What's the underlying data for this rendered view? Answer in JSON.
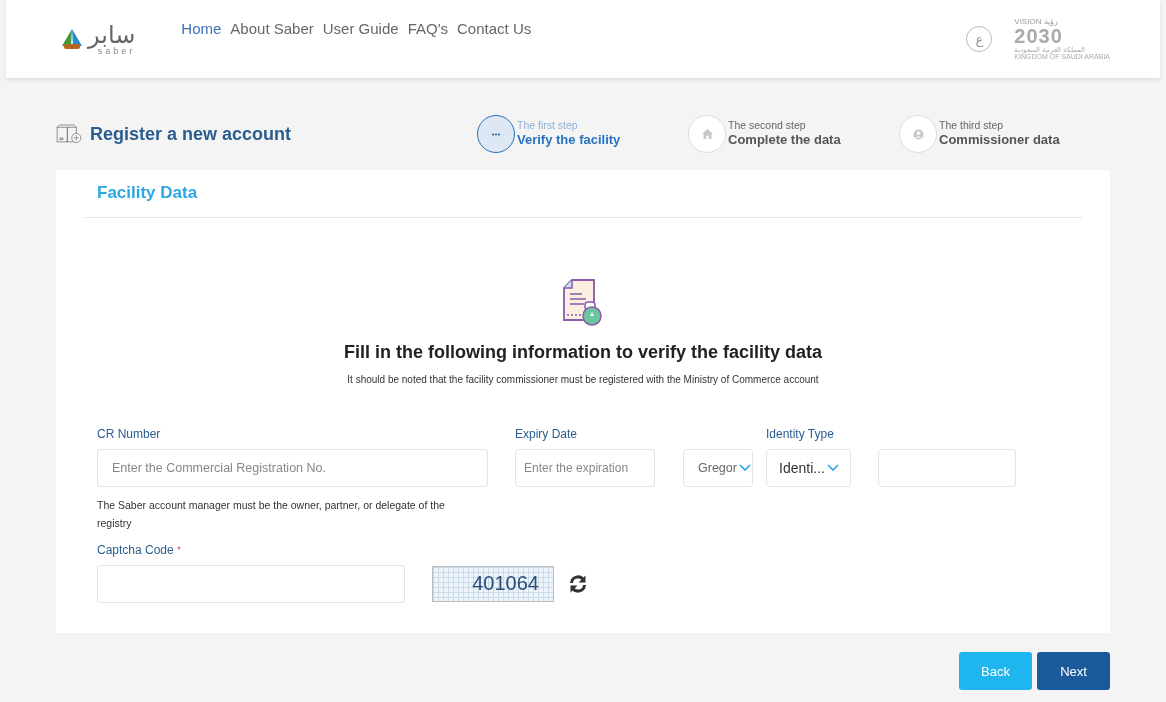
{
  "header": {
    "logo": {
      "arabic": "سابر",
      "latin": "saber"
    },
    "nav": [
      {
        "label": "Home",
        "selected": true
      },
      {
        "label": "About Saber",
        "selected": false
      },
      {
        "label": "User Guide",
        "selected": false
      },
      {
        "label": "FAQ's",
        "selected": false
      },
      {
        "label": "Contact Us",
        "selected": false
      }
    ],
    "language_button": "ع",
    "vision_logo": {
      "top_latin": "VISION",
      "top_arabic": "رؤية",
      "year": "2030",
      "line_arabic": "المملكة العربية السعودية",
      "line_latin": "KINGDOM OF SAUDI ARABIA"
    }
  },
  "page_title": "Register a new account",
  "steps": [
    {
      "kind": "dots",
      "caption": "The first step",
      "label": "Verify the facility",
      "selected": true
    },
    {
      "kind": "home",
      "caption": "The second step",
      "label": "Complete the data",
      "selected": false
    },
    {
      "kind": "person",
      "caption": "The third step",
      "label": "Commissioner data",
      "selected": false
    }
  ],
  "section_title": "Facility Data",
  "heading": "Fill in the following information to verify the facility data",
  "subheading": "It should be noted that the facility commissioner must be registered with the Ministry of Commerce account",
  "form": {
    "cr_number": {
      "label": "CR Number",
      "placeholder": "Enter the Commercial Registration No.",
      "note": "The Saber account manager must be the owner, partner, or delegate of the registry"
    },
    "expiry_date": {
      "label": "Expiry Date",
      "placeholder": "Enter the expiration",
      "calendar": "Gregor"
    },
    "identity_type": {
      "label": "Identity Type",
      "value": "Identi..."
    },
    "captcha": {
      "label": "Captcha Code",
      "required_mark": "*",
      "code": "401064"
    }
  },
  "buttons": [
    {
      "kind": "secondary",
      "label": "Back"
    },
    {
      "kind": "primary",
      "label": "Next"
    }
  ]
}
